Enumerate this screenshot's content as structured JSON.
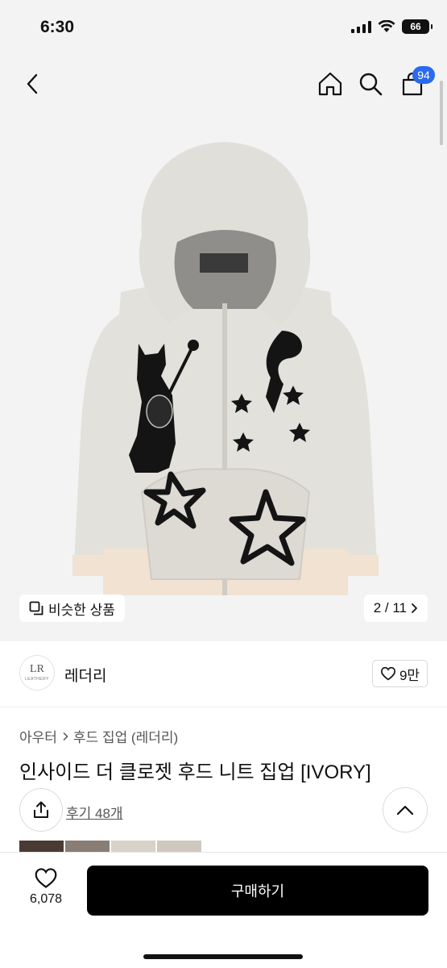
{
  "status_bar": {
    "time": "6:30",
    "battery": "66"
  },
  "nav": {
    "cart_count": "94"
  },
  "image": {
    "similar_label": "비슷한 상품",
    "counter": "2 / 11"
  },
  "brand": {
    "name": "레더리",
    "logo_mark": "LR",
    "logo_sub": "LEATHERY",
    "like_count": "9만"
  },
  "product": {
    "breadcrumb": [
      "아우터",
      "후드 집업 (레더리)"
    ],
    "title": "인사이드 더 클로젯 후드 니트 집업 [IVORY]",
    "review_label": "후기 48개"
  },
  "bottom": {
    "wish_count": "6,078",
    "buy_label": "구매하기"
  },
  "colors": {
    "accent": "#2a6af0",
    "garment": "#e3e1db",
    "trim": "#f1e2d2",
    "buy_button": "#000000"
  },
  "icons": [
    "back-icon",
    "home-icon",
    "search-icon",
    "cart-icon",
    "copy-icon",
    "chevron-right-icon",
    "heart-icon",
    "share-icon",
    "chevron-up-icon"
  ]
}
